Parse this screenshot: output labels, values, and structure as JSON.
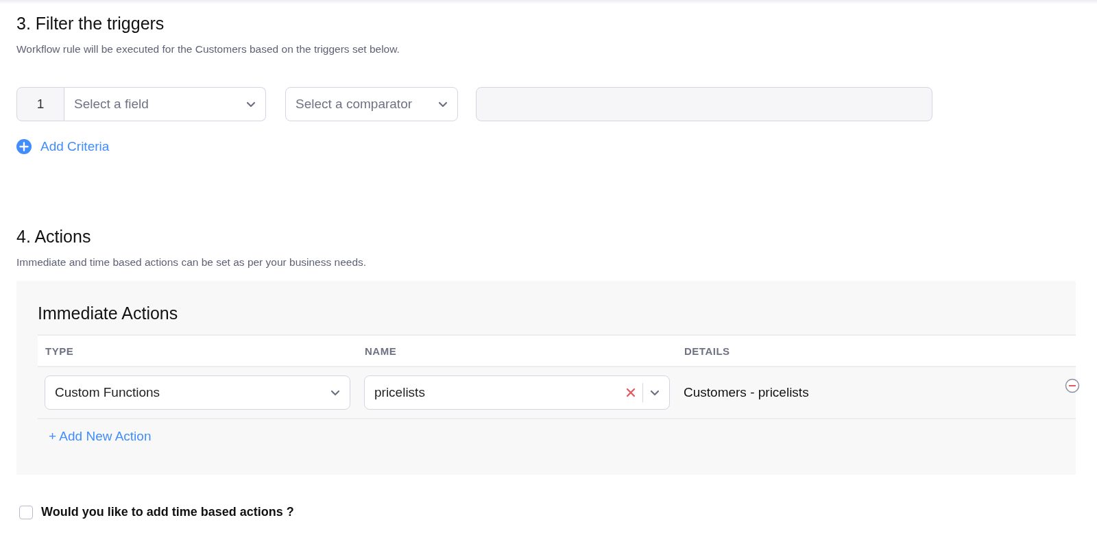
{
  "filter": {
    "heading": "3. Filter the triggers",
    "description": "Workflow rule will be executed for the Customers based on the triggers set below.",
    "criteria": [
      {
        "number": "1",
        "field_placeholder": "Select a field",
        "comparator_placeholder": "Select a comparator"
      }
    ],
    "add_criteria": "Add Criteria"
  },
  "actions": {
    "heading": "4. Actions",
    "description": "Immediate and time based actions can be set as per your business needs.",
    "immediate": {
      "title": "Immediate Actions",
      "columns": [
        "TYPE",
        "NAME",
        "DETAILS"
      ],
      "rows": [
        {
          "type": "Custom Functions",
          "name": "pricelists",
          "details": "Customers - pricelists"
        }
      ],
      "add_action": "+ Add New Action"
    }
  },
  "time_based": {
    "label": "Would you like to add time based actions ?",
    "checked": false
  }
}
